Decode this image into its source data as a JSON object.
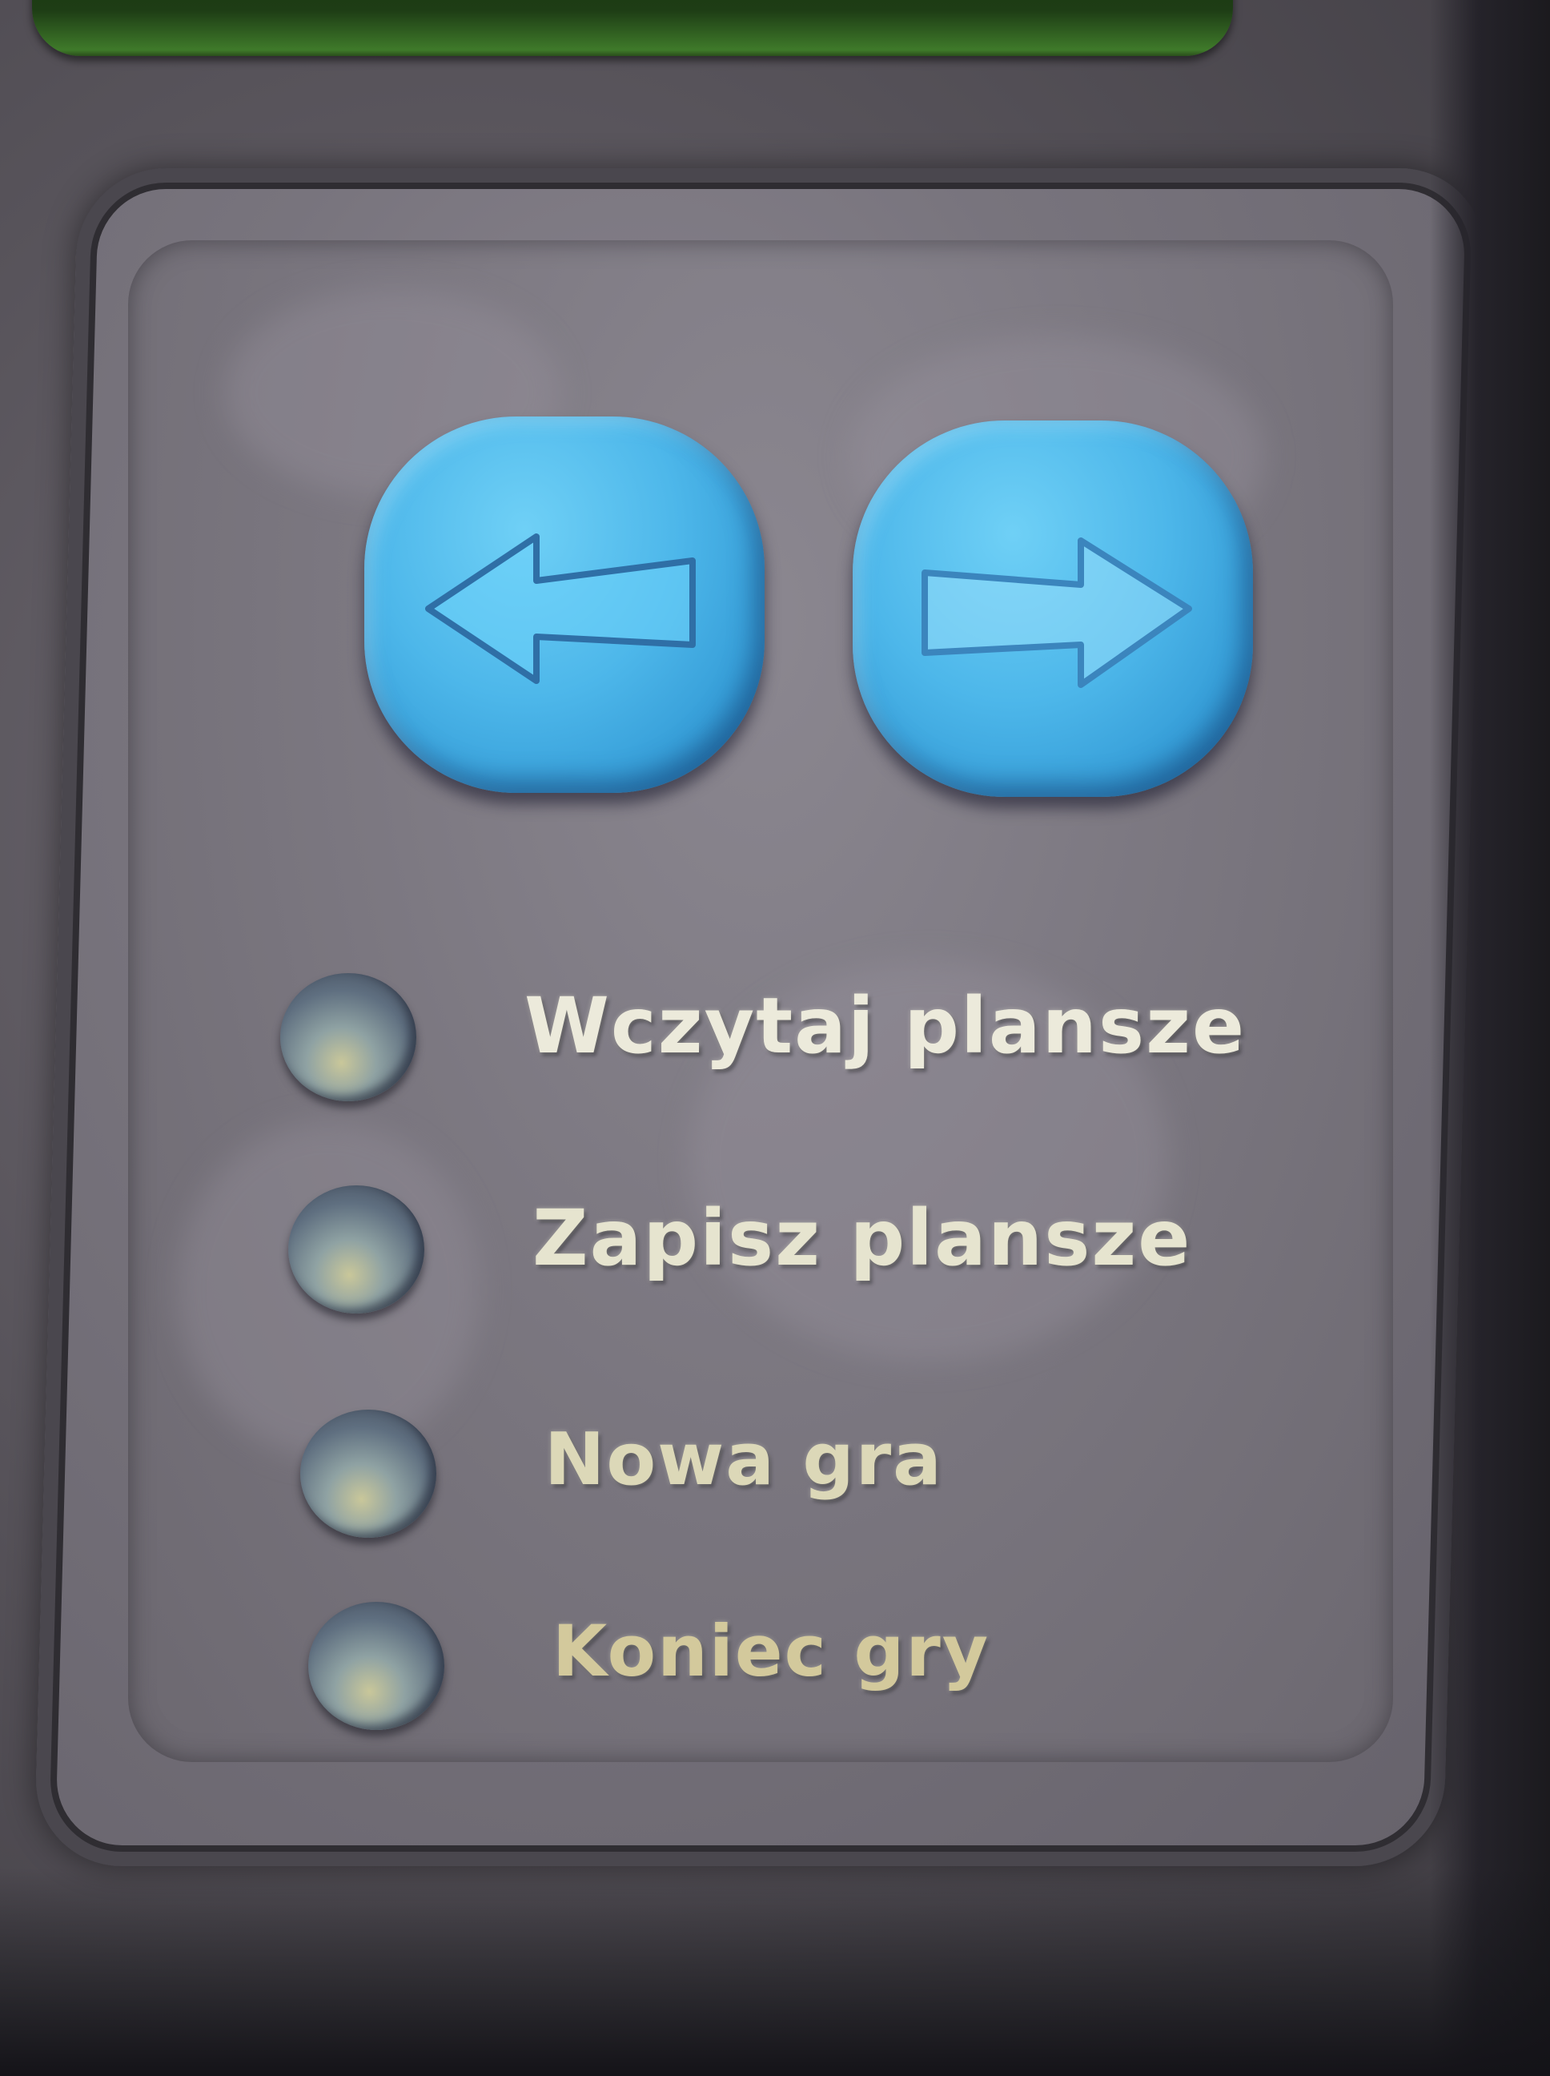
{
  "navigation": {
    "prev_button": {
      "icon": "arrow-left-icon"
    },
    "next_button": {
      "icon": "arrow-right-icon"
    }
  },
  "menu": {
    "items": [
      {
        "label": "Wczytaj plansze"
      },
      {
        "label": "Zapisz plansze"
      },
      {
        "label": "Nowa gra"
      },
      {
        "label": "Koniec gry"
      }
    ]
  },
  "colors": {
    "button_blue": "#4db7ea",
    "panel_gray": "#7c7881",
    "label_text": "#e3e2cf",
    "accent_green": "#3f7a2a"
  }
}
